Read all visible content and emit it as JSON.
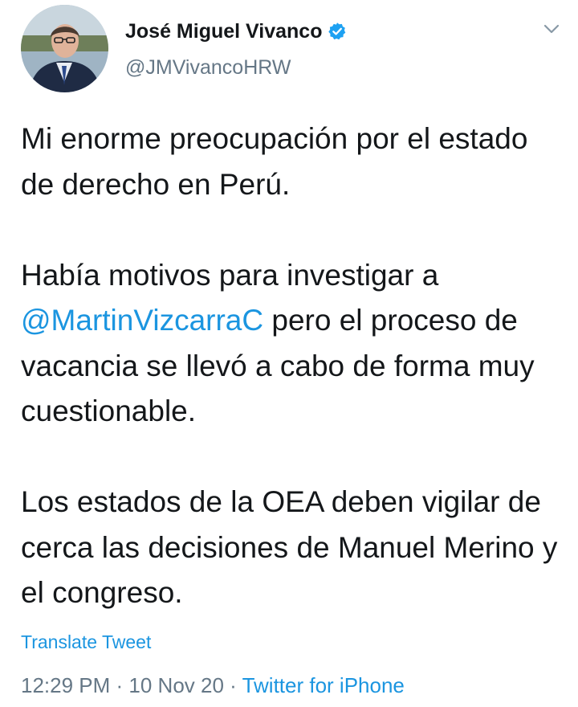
{
  "author": {
    "display_name": "José Miguel Vivanco",
    "handle": "@JMVivancoHRW",
    "verified": true,
    "avatar_icon": "profile-photo"
  },
  "tweet": {
    "paragraph_1": "Mi enorme preocupación por el estado de derecho en Perú.",
    "paragraph_2_before": "Había motivos para investigar a ",
    "paragraph_2_mention": "@MartinVizcarraC",
    "paragraph_2_after": " pero el proceso de vacancia se llevó a cabo de forma muy cuestionable.",
    "paragraph_3": "Los estados de la OEA deben vigilar de cerca las decisiones de Manuel Merino y el congreso."
  },
  "translate_label": "Translate Tweet",
  "meta": {
    "time": "12:29 PM",
    "separator": " · ",
    "date": "10 Nov 20",
    "source": "Twitter for iPhone"
  },
  "colors": {
    "link": "#1b95e0",
    "secondary_text": "#657786",
    "primary_text": "#14171a",
    "verified_badge": "#1da1f2"
  }
}
